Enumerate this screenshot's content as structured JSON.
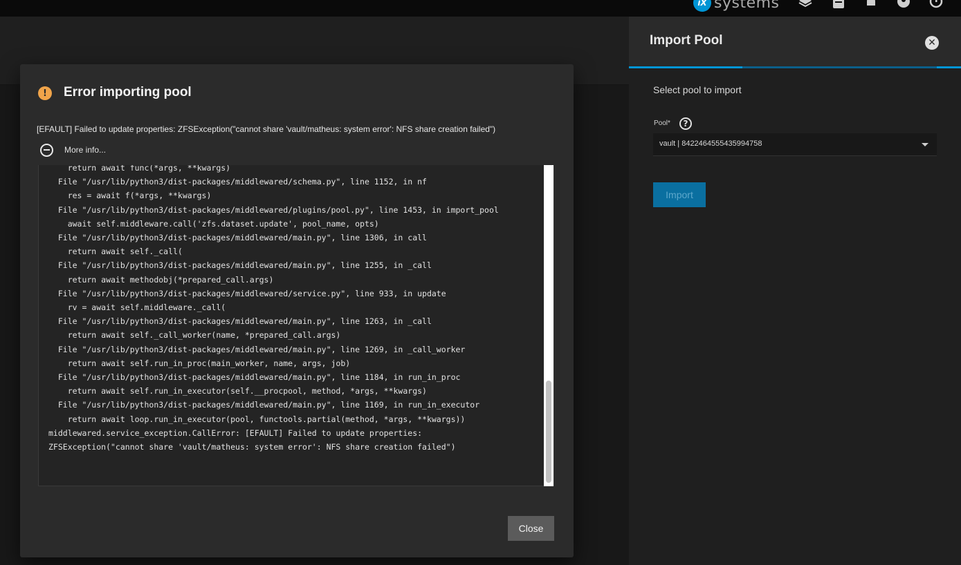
{
  "topbar": {
    "brand_mark": "iX",
    "brand_text": "systems",
    "icons": [
      "truecommand-icon",
      "clipboard-icon",
      "bell-icon",
      "user-icon",
      "power-icon"
    ]
  },
  "panel": {
    "title": "Import Pool",
    "subtitle": "Select pool to import",
    "pool_label": "Pool",
    "pool_required": "*",
    "pool_value": "vault | 8422464555435994758",
    "import_label": "Import",
    "progress_fraction": 0.34
  },
  "dialog": {
    "title": "Error importing pool",
    "message": "[EFAULT] Failed to update properties: ZFSException(\"cannot share 'vault/matheus: system error': NFS share creation failed\")",
    "more_info": "More info...",
    "close_label": "Close",
    "trace_lines": [
      "    return await func(*args, **kwargs)",
      "  File \"/usr/lib/python3/dist-packages/middlewared/schema.py\", line 1152, in nf",
      "    res = await f(*args, **kwargs)",
      "  File \"/usr/lib/python3/dist-packages/middlewared/plugins/pool.py\", line 1453, in import_pool",
      "    await self.middleware.call('zfs.dataset.update', pool_name, opts)",
      "  File \"/usr/lib/python3/dist-packages/middlewared/main.py\", line 1306, in call",
      "    return await self._call(",
      "  File \"/usr/lib/python3/dist-packages/middlewared/main.py\", line 1255, in _call",
      "    return await methodobj(*prepared_call.args)",
      "  File \"/usr/lib/python3/dist-packages/middlewared/service.py\", line 933, in update",
      "    rv = await self.middleware._call(",
      "  File \"/usr/lib/python3/dist-packages/middlewared/main.py\", line 1263, in _call",
      "    return await self._call_worker(name, *prepared_call.args)",
      "  File \"/usr/lib/python3/dist-packages/middlewared/main.py\", line 1269, in _call_worker",
      "    return await self.run_in_proc(main_worker, name, args, job)",
      "  File \"/usr/lib/python3/dist-packages/middlewared/main.py\", line 1184, in run_in_proc",
      "    return await self.run_in_executor(self.__procpool, method, *args, **kwargs)",
      "  File \"/usr/lib/python3/dist-packages/middlewared/main.py\", line 1169, in run_in_executor",
      "    return await loop.run_in_executor(pool, functools.partial(method, *args, **kwargs))",
      "middlewared.service_exception.CallError: [EFAULT] Failed to update properties:",
      "ZFSException(\"cannot share 'vault/matheus: system error': NFS share creation failed\")"
    ]
  }
}
